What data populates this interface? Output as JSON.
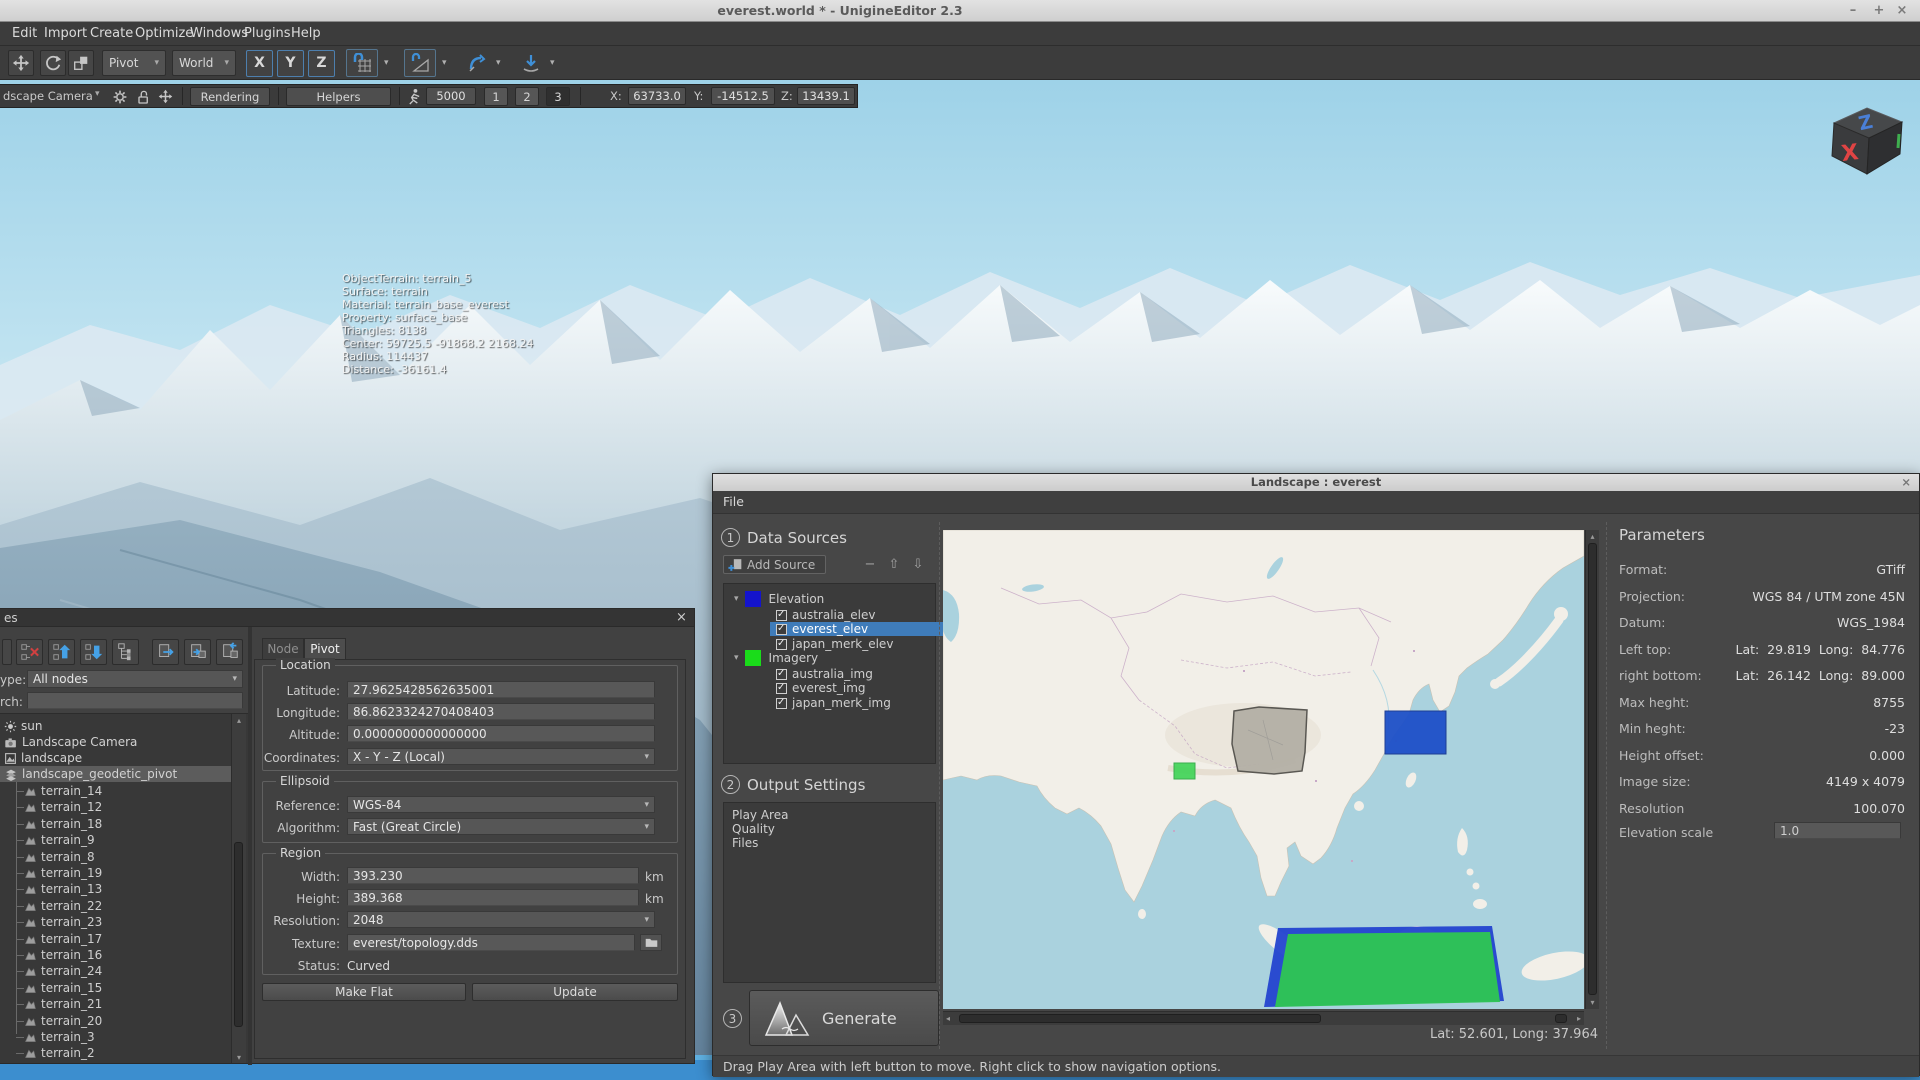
{
  "window": {
    "title": "everest.world * - UnigineEditor 2.3",
    "minimize": "–",
    "maximize": "+",
    "close": "×"
  },
  "icons": {
    "caret_down": "▾",
    "tri_up": "▴",
    "tri_down": "▾",
    "tri_left": "◂",
    "tri_right": "▸",
    "check": "✓"
  },
  "menubar": {
    "items": [
      "Edit",
      "Import",
      "Create",
      "Optimize",
      "Windows",
      "Plugins",
      "Help"
    ]
  },
  "toolbar": {
    "pivot": "Pivot",
    "world": "World",
    "axes": [
      "X",
      "Y",
      "Z"
    ]
  },
  "camera_bar": {
    "camera": "dscape Camera",
    "rendering": "Rendering",
    "helpers": "Helpers",
    "speed": "5000",
    "preset1": "1",
    "preset2": "2",
    "preset3": "3",
    "x_label": "X:",
    "x_value": "63733.0",
    "y_label": "Y:",
    "y_value": "-14512.5",
    "z_label": "Z:",
    "z_value": "13439.1"
  },
  "viewport": {
    "info_lines": [
      "ObjectTerrain: terrain_5",
      "Surface: terrain",
      "Material: terrain_base_everest",
      "Property: surface_base",
      "Triangles: 8138",
      "Center: 59725.5 -91868.2 2168.24",
      "Radius: 114437",
      "Distance: -36161.4"
    ],
    "gizmo_top": "Z",
    "gizmo_front": "X"
  },
  "nodes_panel": {
    "title": "es",
    "close": "×",
    "type_label": "ype:",
    "type_value": "All nodes",
    "search_label": "rch:",
    "root_items": [
      {
        "label": "sun"
      },
      {
        "label": "Landscape Camera"
      },
      {
        "label": "landscape"
      },
      {
        "label": "landscape_geodetic_pivot"
      }
    ],
    "terrain_items": [
      "terrain_14",
      "terrain_12",
      "terrain_18",
      "terrain_9",
      "terrain_8",
      "terrain_19",
      "terrain_13",
      "terrain_22",
      "terrain_23",
      "terrain_17",
      "terrain_16",
      "terrain_24",
      "terrain_15",
      "terrain_21",
      "terrain_20",
      "terrain_3",
      "terrain_2"
    ],
    "tabs": {
      "node": "Node",
      "pivot": "Pivot"
    },
    "location": {
      "title": "Location",
      "latitude_label": "Latitude:",
      "latitude": "27.9625428562635001",
      "longitude_label": "Longitude:",
      "longitude": "86.8623324270408403",
      "altitude_label": "Altitude:",
      "altitude": "0.0000000000000000",
      "coordinates_label": "Coordinates:",
      "coordinates": "X - Y - Z (Local)"
    },
    "ellipsoid": {
      "title": "Ellipsoid",
      "reference_label": "Reference:",
      "reference": "WGS-84",
      "algorithm_label": "Algorithm:",
      "algorithm": "Fast (Great Circle)"
    },
    "region": {
      "title": "Region",
      "width_label": "Width:",
      "width": "393.230",
      "width_unit": "km",
      "height_label": "Height:",
      "height": "389.368",
      "height_unit": "km",
      "resolution_label": "Resolution:",
      "resolution": "2048",
      "texture_label": "Texture:",
      "texture": "everest/topology.dds",
      "status_label": "Status:",
      "status": "Curved"
    },
    "make_flat": "Make Flat",
    "update": "Update"
  },
  "landscape_dialog": {
    "title": "Landscape : everest",
    "close": "×",
    "menu_file": "File",
    "data_sources": {
      "step": "1",
      "title": "Data Sources",
      "add_source": "Add Source",
      "remove": "−",
      "move_up": "⇧",
      "move_down": "⇩",
      "elevation_group": {
        "name": "Elevation",
        "color": "#1414cc",
        "items": [
          "australia_elev",
          "everest_elev",
          "japan_merk_elev"
        ]
      },
      "imagery_group": {
        "name": "Imagery",
        "color": "#1adc1a",
        "items": [
          "australia_img",
          "everest_img",
          "japan_merk_img"
        ]
      }
    },
    "output_settings": {
      "step": "2",
      "title": "Output Settings",
      "items": [
        "Play Area",
        "Quality",
        "Files"
      ]
    },
    "generate": {
      "step": "3",
      "label": "Generate"
    },
    "map": {
      "status": "Lat: 52.601, Long: 37.964",
      "land_color": "#f2efe8",
      "water_color": "#aad2de",
      "play_area_fill": "#b3afa5",
      "elevation_japan_fill": "#1e50c8",
      "imagery_nepal_fill": "#3ed455",
      "bottom_elevation_fill": "#2343cf",
      "bottom_imagery_fill": "#2ec455"
    },
    "parameters": {
      "title": "Parameters",
      "rows": [
        {
          "label": "Format:",
          "value": "GTiff"
        },
        {
          "label": "Projection:",
          "value": "WGS 84 / UTM zone 45N"
        },
        {
          "label": "Datum:",
          "value": "WGS_1984"
        },
        {
          "label": "Left top:",
          "value": "Lat:  29.819  Long:  84.776"
        },
        {
          "label": "right bottom:",
          "value": "Lat:  26.142  Long:  89.000"
        },
        {
          "label": "Max heght:",
          "value": "8755"
        },
        {
          "label": "Min heght:",
          "value": "-23"
        },
        {
          "label": "Height offset:",
          "value": "0.000"
        },
        {
          "label": "Image size:",
          "value": "4149 x 4079"
        },
        {
          "label": "Resolution",
          "value": "100.070"
        }
      ],
      "elevation_scale_label": "Elevation scale",
      "elevation_scale": "1.0"
    },
    "status_bar": "Drag Play Area with left button to move. Right click to show navigation options."
  }
}
